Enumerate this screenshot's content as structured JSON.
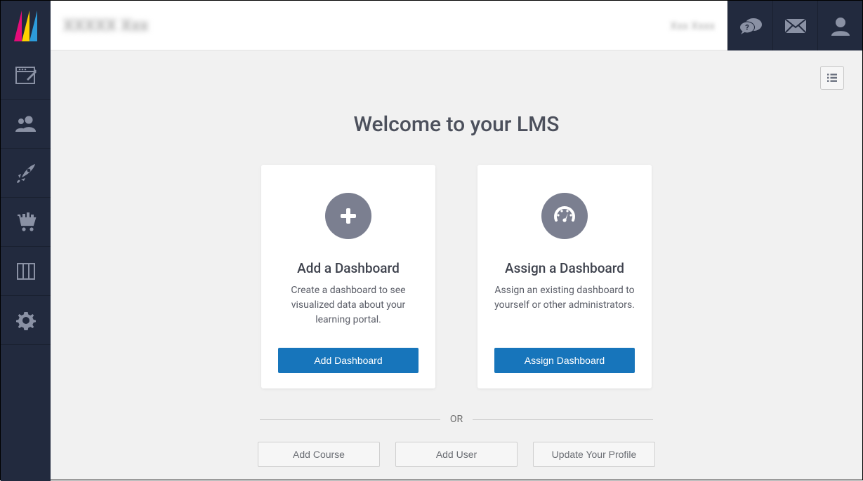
{
  "header": {
    "blur_left": "XXXXX Xxx",
    "blur_right": "Xxx Xxxx"
  },
  "page": {
    "title": "Welcome to your LMS",
    "or_label": "OR"
  },
  "cards": {
    "add": {
      "title": "Add a Dashboard",
      "desc": "Create a dashboard to see visualized data about your learning portal.",
      "button": "Add Dashboard"
    },
    "assign": {
      "title": "Assign a Dashboard",
      "desc": "Assign an existing dashboard to yourself or other administrators.",
      "button": "Assign Dashboard"
    }
  },
  "secondary_buttons": {
    "add_course": "Add Course",
    "add_user": "Add User",
    "update_profile": "Update Your Profile"
  }
}
